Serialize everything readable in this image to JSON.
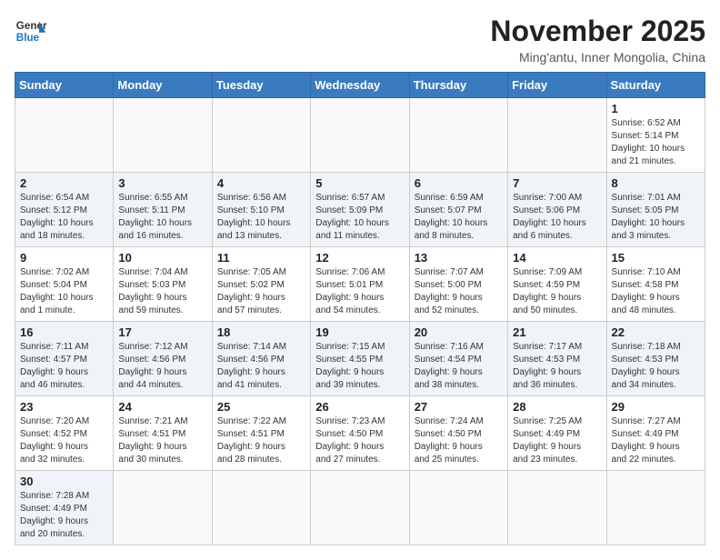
{
  "header": {
    "logo_general": "General",
    "logo_blue": "Blue",
    "month_title": "November 2025",
    "location": "Ming'antu, Inner Mongolia, China"
  },
  "weekdays": [
    "Sunday",
    "Monday",
    "Tuesday",
    "Wednesday",
    "Thursday",
    "Friday",
    "Saturday"
  ],
  "weeks": [
    [
      {
        "day": "",
        "info": ""
      },
      {
        "day": "",
        "info": ""
      },
      {
        "day": "",
        "info": ""
      },
      {
        "day": "",
        "info": ""
      },
      {
        "day": "",
        "info": ""
      },
      {
        "day": "",
        "info": ""
      },
      {
        "day": "1",
        "info": "Sunrise: 6:52 AM\nSunset: 5:14 PM\nDaylight: 10 hours\nand 21 minutes."
      }
    ],
    [
      {
        "day": "2",
        "info": "Sunrise: 6:54 AM\nSunset: 5:12 PM\nDaylight: 10 hours\nand 18 minutes."
      },
      {
        "day": "3",
        "info": "Sunrise: 6:55 AM\nSunset: 5:11 PM\nDaylight: 10 hours\nand 16 minutes."
      },
      {
        "day": "4",
        "info": "Sunrise: 6:56 AM\nSunset: 5:10 PM\nDaylight: 10 hours\nand 13 minutes."
      },
      {
        "day": "5",
        "info": "Sunrise: 6:57 AM\nSunset: 5:09 PM\nDaylight: 10 hours\nand 11 minutes."
      },
      {
        "day": "6",
        "info": "Sunrise: 6:59 AM\nSunset: 5:07 PM\nDaylight: 10 hours\nand 8 minutes."
      },
      {
        "day": "7",
        "info": "Sunrise: 7:00 AM\nSunset: 5:06 PM\nDaylight: 10 hours\nand 6 minutes."
      },
      {
        "day": "8",
        "info": "Sunrise: 7:01 AM\nSunset: 5:05 PM\nDaylight: 10 hours\nand 3 minutes."
      }
    ],
    [
      {
        "day": "9",
        "info": "Sunrise: 7:02 AM\nSunset: 5:04 PM\nDaylight: 10 hours\nand 1 minute."
      },
      {
        "day": "10",
        "info": "Sunrise: 7:04 AM\nSunset: 5:03 PM\nDaylight: 9 hours\nand 59 minutes."
      },
      {
        "day": "11",
        "info": "Sunrise: 7:05 AM\nSunset: 5:02 PM\nDaylight: 9 hours\nand 57 minutes."
      },
      {
        "day": "12",
        "info": "Sunrise: 7:06 AM\nSunset: 5:01 PM\nDaylight: 9 hours\nand 54 minutes."
      },
      {
        "day": "13",
        "info": "Sunrise: 7:07 AM\nSunset: 5:00 PM\nDaylight: 9 hours\nand 52 minutes."
      },
      {
        "day": "14",
        "info": "Sunrise: 7:09 AM\nSunset: 4:59 PM\nDaylight: 9 hours\nand 50 minutes."
      },
      {
        "day": "15",
        "info": "Sunrise: 7:10 AM\nSunset: 4:58 PM\nDaylight: 9 hours\nand 48 minutes."
      }
    ],
    [
      {
        "day": "16",
        "info": "Sunrise: 7:11 AM\nSunset: 4:57 PM\nDaylight: 9 hours\nand 46 minutes."
      },
      {
        "day": "17",
        "info": "Sunrise: 7:12 AM\nSunset: 4:56 PM\nDaylight: 9 hours\nand 44 minutes."
      },
      {
        "day": "18",
        "info": "Sunrise: 7:14 AM\nSunset: 4:56 PM\nDaylight: 9 hours\nand 41 minutes."
      },
      {
        "day": "19",
        "info": "Sunrise: 7:15 AM\nSunset: 4:55 PM\nDaylight: 9 hours\nand 39 minutes."
      },
      {
        "day": "20",
        "info": "Sunrise: 7:16 AM\nSunset: 4:54 PM\nDaylight: 9 hours\nand 38 minutes."
      },
      {
        "day": "21",
        "info": "Sunrise: 7:17 AM\nSunset: 4:53 PM\nDaylight: 9 hours\nand 36 minutes."
      },
      {
        "day": "22",
        "info": "Sunrise: 7:18 AM\nSunset: 4:53 PM\nDaylight: 9 hours\nand 34 minutes."
      }
    ],
    [
      {
        "day": "23",
        "info": "Sunrise: 7:20 AM\nSunset: 4:52 PM\nDaylight: 9 hours\nand 32 minutes."
      },
      {
        "day": "24",
        "info": "Sunrise: 7:21 AM\nSunset: 4:51 PM\nDaylight: 9 hours\nand 30 minutes."
      },
      {
        "day": "25",
        "info": "Sunrise: 7:22 AM\nSunset: 4:51 PM\nDaylight: 9 hours\nand 28 minutes."
      },
      {
        "day": "26",
        "info": "Sunrise: 7:23 AM\nSunset: 4:50 PM\nDaylight: 9 hours\nand 27 minutes."
      },
      {
        "day": "27",
        "info": "Sunrise: 7:24 AM\nSunset: 4:50 PM\nDaylight: 9 hours\nand 25 minutes."
      },
      {
        "day": "28",
        "info": "Sunrise: 7:25 AM\nSunset: 4:49 PM\nDaylight: 9 hours\nand 23 minutes."
      },
      {
        "day": "29",
        "info": "Sunrise: 7:27 AM\nSunset: 4:49 PM\nDaylight: 9 hours\nand 22 minutes."
      }
    ],
    [
      {
        "day": "30",
        "info": "Sunrise: 7:28 AM\nSunset: 4:49 PM\nDaylight: 9 hours\nand 20 minutes."
      },
      {
        "day": "",
        "info": ""
      },
      {
        "day": "",
        "info": ""
      },
      {
        "day": "",
        "info": ""
      },
      {
        "day": "",
        "info": ""
      },
      {
        "day": "",
        "info": ""
      },
      {
        "day": "",
        "info": ""
      }
    ]
  ]
}
